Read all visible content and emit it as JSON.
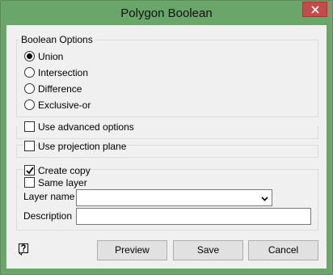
{
  "window": {
    "title": "Polygon Boolean"
  },
  "boolean_options": {
    "title": "Boolean Options",
    "selected": "Union",
    "options": [
      "Union",
      "Intersection",
      "Difference",
      "Exclusive-or"
    ]
  },
  "advanced": {
    "label": "Use advanced options",
    "checked": false
  },
  "projection": {
    "label": "Use projection plane",
    "checked": false
  },
  "copy": {
    "create_copy_label": "Create copy",
    "create_copy_checked": true,
    "same_layer_label": "Same layer",
    "same_layer_checked": false,
    "layer_name_label": "Layer name",
    "layer_name_value": "",
    "description_label": "Description",
    "description_value": ""
  },
  "icons": {
    "help": "help-question-icon",
    "close": "close-x-icon",
    "dropdown": "chevron-down-icon",
    "check": "checkmark-icon"
  },
  "buttons": {
    "preview": "Preview",
    "save": "Save",
    "cancel": "Cancel"
  }
}
